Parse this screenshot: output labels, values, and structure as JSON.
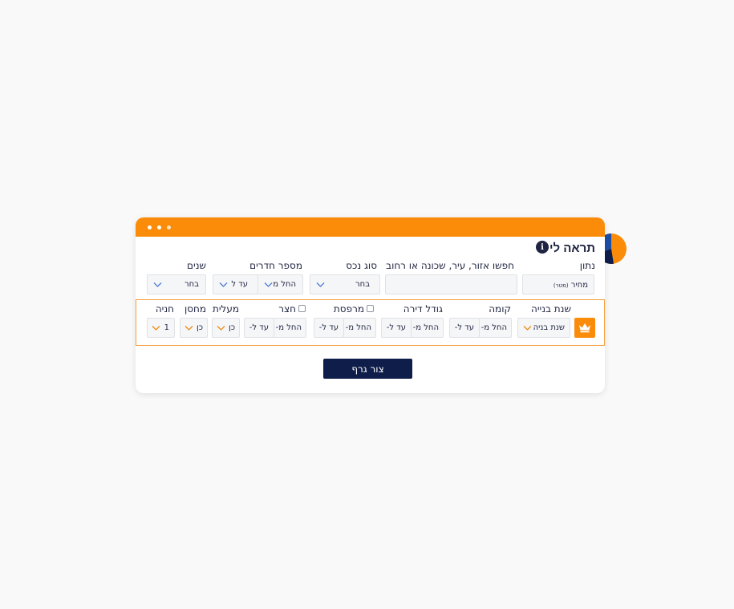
{
  "window": {
    "title": "תראה לי",
    "info_icon": "i",
    "button_label": "צור גרף"
  },
  "row1": {
    "metric": {
      "label": "נתון",
      "value_main": "מחיר",
      "value_unit": "(מטר)"
    },
    "search": {
      "label": "חפשו אזור, עיר, שכונה או רחוב",
      "value": ""
    },
    "asset_type": {
      "label": "סוג נכס",
      "value": "בחר"
    },
    "rooms": {
      "label": "מספר חדרים",
      "from": "החל מ",
      "to": "עד ל"
    },
    "years": {
      "label": "שנים",
      "value": "בחר"
    }
  },
  "row2": {
    "build_year": {
      "label": "שנת בנייה",
      "value": "שנת בניה"
    },
    "floor": {
      "label": "קומה",
      "from": "החל מ-",
      "to": "עד ל-"
    },
    "size": {
      "label": "גודל דירה",
      "from": "החל מ-",
      "to": "עד ל-"
    },
    "balcony": {
      "label": "מרפסת",
      "from": "החל מ-",
      "to": "עד ל-"
    },
    "yard": {
      "label": "חצר",
      "from": "החל מ-",
      "to": "עד ל-"
    },
    "elevator": {
      "label": "מעלית",
      "value": "כן"
    },
    "storage": {
      "label": "מחסן",
      "value": "כן"
    },
    "parking": {
      "label": "חניה",
      "value": "1"
    }
  },
  "colors": {
    "accent": "#fb8c0a",
    "navy": "#0e1d4a",
    "chevron_blue": "#4a7ad8",
    "chevron_orange": "#f08a10"
  },
  "icons": {
    "logo": "pie-chart-icon",
    "premium": "crown-icon",
    "dropdown": "chevron-down-icon",
    "info": "info-icon"
  }
}
